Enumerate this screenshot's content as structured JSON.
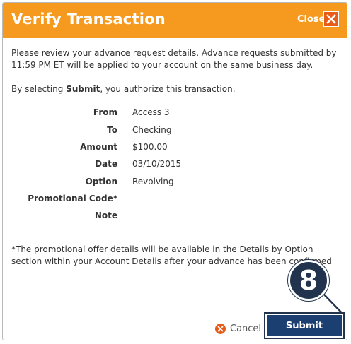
{
  "dialog": {
    "title": "Verify Transaction",
    "close_label": "Close",
    "intro_text": "Please review your advance request details. Advance requests submitted by 11:59 PM ET will be applied to your account on the same business day.",
    "authorize_prefix": "By selecting ",
    "authorize_bold": "Submit",
    "authorize_suffix": ", you authorize this transaction.",
    "fields": [
      {
        "label": "From",
        "value": "Access 3"
      },
      {
        "label": "To",
        "value": "Checking"
      },
      {
        "label": "Amount",
        "value": "$100.00"
      },
      {
        "label": "Date",
        "value": "03/10/2015"
      },
      {
        "label": "Option",
        "value": "Revolving"
      },
      {
        "label": "Promotional Code*",
        "value": ""
      },
      {
        "label": "Note",
        "value": ""
      }
    ],
    "footnote": "*The promotional offer details will be available in the Details by Option section within your Account Details after your advance has been confirmed",
    "cancel_label": "Cancel",
    "submit_label": "Submit"
  },
  "callout": {
    "step_number": "8"
  },
  "colors": {
    "header": "#f59a1e",
    "close_box": "#e65c18",
    "submit": "#1b3f71",
    "callout": "#22344d"
  },
  "icons": {
    "close": "close-x-icon",
    "cancel": "cancel-circle-icon"
  }
}
